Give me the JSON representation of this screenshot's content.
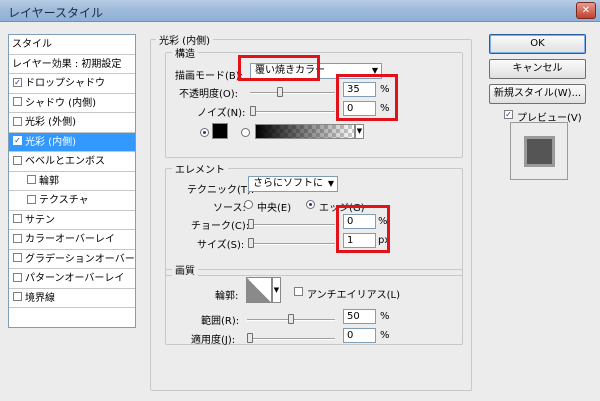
{
  "window": {
    "title": "レイヤースタイル",
    "close_glyph": "✕"
  },
  "style_list": {
    "items": [
      {
        "label": "スタイル",
        "type": "header"
      },
      {
        "label": "レイヤー効果 : 初期設定",
        "type": "header"
      },
      {
        "label": "ドロップシャドウ",
        "checked": true
      },
      {
        "label": "シャドウ (内側)",
        "checked": false
      },
      {
        "label": "光彩 (外側)",
        "checked": false
      },
      {
        "label": "光彩 (内側)",
        "checked": true,
        "selected": true
      },
      {
        "label": "ベベルとエンボス",
        "checked": false
      },
      {
        "label": "輪郭",
        "checked": false,
        "indent": true
      },
      {
        "label": "テクスチャ",
        "checked": false,
        "indent": true
      },
      {
        "label": "サテン",
        "checked": false
      },
      {
        "label": "カラーオーバーレイ",
        "checked": false
      },
      {
        "label": "グラデーションオーバーレイ",
        "checked": false
      },
      {
        "label": "パターンオーバーレイ",
        "checked": false
      },
      {
        "label": "境界線",
        "checked": false
      }
    ]
  },
  "panel": {
    "title": "光彩 (内側)",
    "structure": {
      "title": "構造",
      "blend_mode_label": "描画モード(B):",
      "blend_mode_value": "覆い焼きカラー",
      "opacity_label": "不透明度(O):",
      "opacity_value": "35",
      "opacity_fraction": 0.35,
      "noise_label": "ノイズ(N):",
      "noise_value": "0",
      "unit_percent": "%"
    },
    "elements": {
      "title": "エレメント",
      "technique_label": "テクニック(T):",
      "technique_value": "さらにソフトに",
      "source_label": "ソース:",
      "source_center": "中央(E)",
      "source_edge": "エッジ(G)",
      "choke_label": "チョーク(C):",
      "choke_value": "0",
      "size_label": "サイズ(S):",
      "size_value": "1",
      "unit_px": "px"
    },
    "quality": {
      "title": "画質",
      "contour_label": "輪郭:",
      "antialias_label": "アンチエイリアス(L)",
      "range_label": "範囲(R):",
      "range_value": "50",
      "range_fraction": 0.5,
      "jitter_label": "適用度(J):",
      "jitter_value": "0"
    }
  },
  "buttons": {
    "ok": "OK",
    "cancel": "キャンセル",
    "new_style": "新規スタイル(W)...",
    "preview_label": "プレビュー(V)"
  },
  "colors": {
    "highlight": "#e2121b",
    "selection": "#3399ff"
  }
}
